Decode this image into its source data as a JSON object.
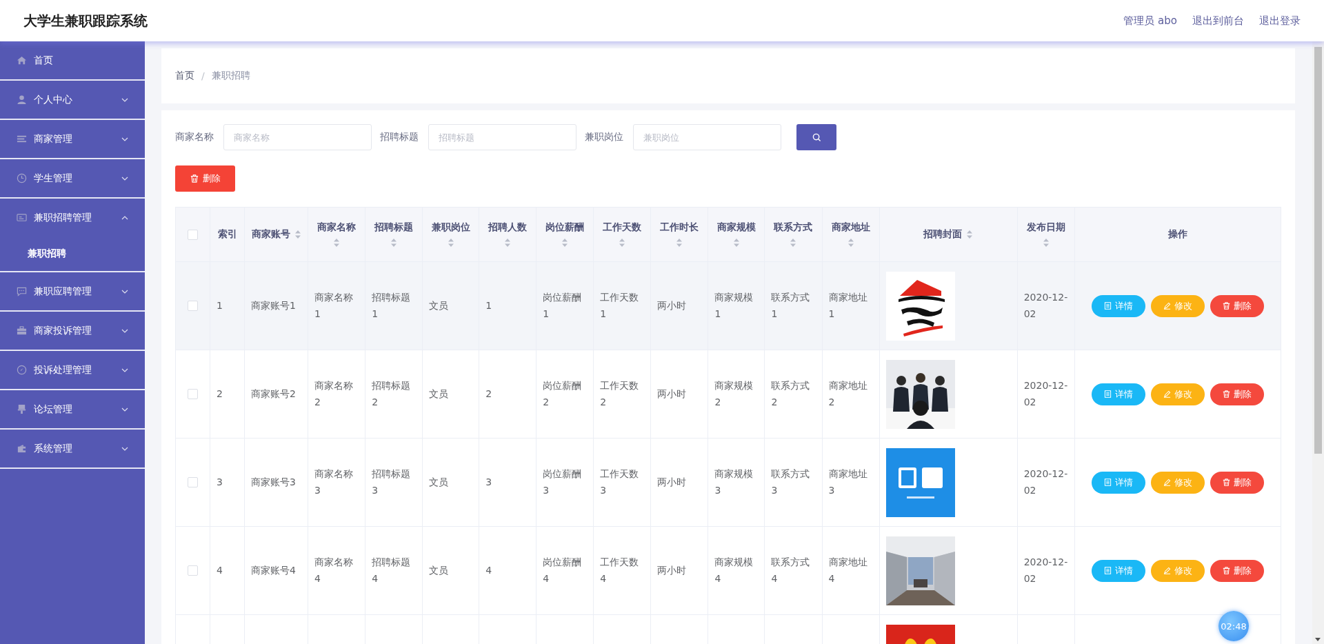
{
  "header": {
    "title": "大学生兼职跟踪系统",
    "links": [
      "管理员 abo",
      "退出到前台",
      "退出登录"
    ]
  },
  "sidebar": {
    "items": [
      {
        "label": "首页"
      },
      {
        "label": "个人中心",
        "expanded": false
      },
      {
        "label": "商家管理",
        "expanded": false
      },
      {
        "label": "学生管理",
        "expanded": false
      },
      {
        "label": "兼职招聘管理",
        "expanded": true,
        "children": [
          {
            "label": "兼职招聘",
            "selected": true
          }
        ]
      },
      {
        "label": "兼职应聘管理",
        "expanded": false
      },
      {
        "label": "商家投诉管理",
        "expanded": false
      },
      {
        "label": "投诉处理管理",
        "expanded": false
      },
      {
        "label": "论坛管理",
        "expanded": false
      },
      {
        "label": "系统管理",
        "expanded": false
      }
    ]
  },
  "breadcrumb": {
    "items": [
      "首页",
      "兼职招聘"
    ],
    "separator": "/"
  },
  "filters": [
    {
      "label": "商家名称",
      "placeholder": "商家名称"
    },
    {
      "label": "招聘标题",
      "placeholder": "招聘标题"
    },
    {
      "label": "兼职岗位",
      "placeholder": "兼职岗位"
    }
  ],
  "delete_button": "删除",
  "table": {
    "header_checked": false,
    "columns": [
      {
        "label": "索引",
        "sortable": false
      },
      {
        "label": "商家账号",
        "sortable": true
      },
      {
        "label": "商家名称",
        "sortable": true
      },
      {
        "label": "招聘标题",
        "sortable": true
      },
      {
        "label": "兼职岗位",
        "sortable": true
      },
      {
        "label": "招聘人数",
        "sortable": true
      },
      {
        "label": "岗位薪酬",
        "sortable": true
      },
      {
        "label": "工作天数",
        "sortable": true
      },
      {
        "label": "工作时长",
        "sortable": true
      },
      {
        "label": "商家规模",
        "sortable": true
      },
      {
        "label": "联系方式",
        "sortable": true
      },
      {
        "label": "商家地址",
        "sortable": true
      },
      {
        "label": "招聘封面",
        "sortable": true
      },
      {
        "label": "发布日期",
        "sortable": true
      },
      {
        "label": "操作",
        "sortable": false
      }
    ],
    "rows": [
      {
        "hovered": true,
        "checked": false,
        "index": "1",
        "cells": [
          "商家账号1",
          "商家名称1",
          "招聘标题1",
          "文员",
          "1",
          "岗位薪酬1",
          "工作天数1",
          "两小时",
          "商家规模1",
          "联系方式1",
          "商家地址1"
        ],
        "date": "2020-12-02",
        "actions": [
          {
            "kind": "detail",
            "label": "详情"
          },
          {
            "kind": "edit",
            "label": "修改"
          },
          {
            "kind": "delete",
            "label": "删除"
          }
        ]
      },
      {
        "hovered": false,
        "checked": false,
        "index": "2",
        "cells": [
          "商家账号2",
          "商家名称2",
          "招聘标题2",
          "文员",
          "2",
          "岗位薪酬2",
          "工作天数2",
          "两小时",
          "商家规模2",
          "联系方式2",
          "商家地址2"
        ],
        "date": "2020-12-02",
        "actions": [
          {
            "kind": "detail",
            "label": "详情"
          },
          {
            "kind": "edit",
            "label": "修改"
          },
          {
            "kind": "delete",
            "label": "删除"
          }
        ]
      },
      {
        "hovered": false,
        "checked": false,
        "index": "3",
        "cells": [
          "商家账号3",
          "商家名称3",
          "招聘标题3",
          "文员",
          "3",
          "岗位薪酬3",
          "工作天数3",
          "两小时",
          "商家规模3",
          "联系方式3",
          "商家地址3"
        ],
        "date": "2020-12-02",
        "actions": [
          {
            "kind": "detail",
            "label": "详情"
          },
          {
            "kind": "edit",
            "label": "修改"
          },
          {
            "kind": "delete",
            "label": "删除"
          }
        ]
      },
      {
        "hovered": false,
        "checked": false,
        "index": "4",
        "cells": [
          "商家账号4",
          "商家名称4",
          "招聘标题4",
          "文员",
          "4",
          "岗位薪酬4",
          "工作天数4",
          "两小时",
          "商家规模4",
          "联系方式4",
          "商家地址4"
        ],
        "date": "2020-12-02",
        "actions": [
          {
            "kind": "detail",
            "label": "详情"
          },
          {
            "kind": "edit",
            "label": "修改"
          },
          {
            "kind": "delete",
            "label": "删除"
          }
        ]
      },
      {
        "hovered": false
      }
    ]
  },
  "clock_badge": "02:48"
}
